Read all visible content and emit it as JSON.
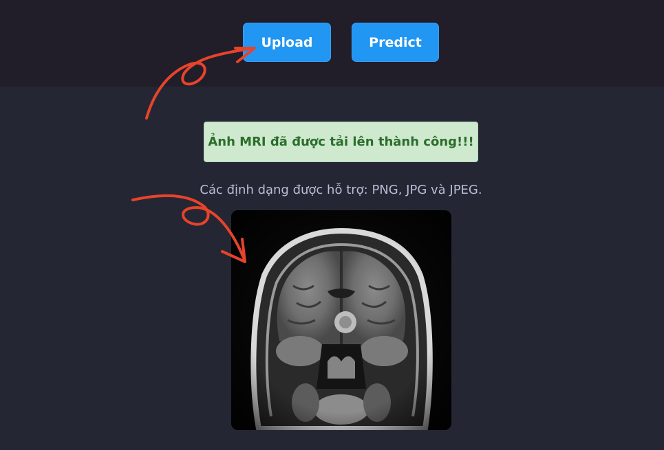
{
  "toolbar": {
    "upload_label": "Upload",
    "predict_label": "Predict"
  },
  "alert": {
    "message": "Ảnh MRI đã được tải lên thành công!!!"
  },
  "formats": {
    "text": "Các định dạng được hỗ trợ: PNG, JPG và JPEG."
  },
  "colors": {
    "button_bg": "#2196f3",
    "alert_bg": "#cfe9cf",
    "alert_text": "#2b6e2b",
    "annotation_arrow": "#e8432b",
    "page_bg": "#242733",
    "topbar_bg": "#211e2a"
  },
  "icons": {
    "arrow_to_upload": "hand-drawn-arrow-icon",
    "arrow_to_image": "hand-drawn-arrow-icon"
  }
}
